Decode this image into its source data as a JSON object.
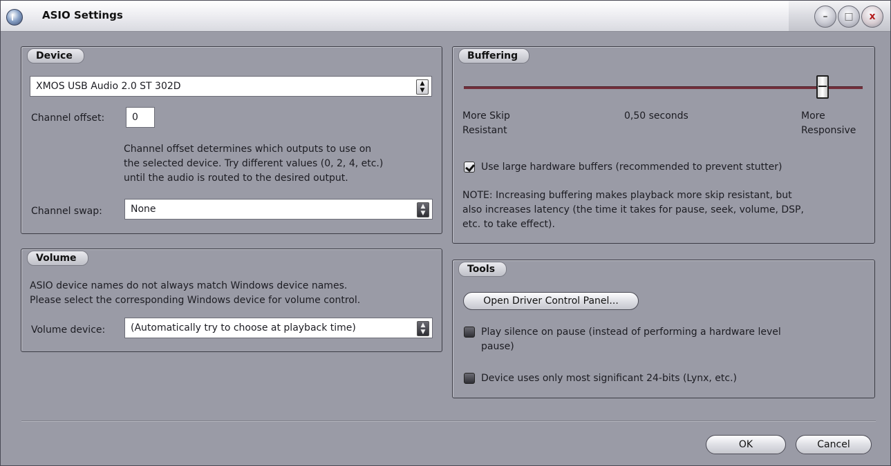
{
  "window": {
    "title": "ASIO Settings",
    "buttons": {
      "minimize": "–",
      "maximize": "□",
      "close": "x"
    }
  },
  "device": {
    "label": "Device",
    "selected_device": "XMOS USB Audio 2.0 ST 302D",
    "channel_offset_label": "Channel offset:",
    "channel_offset_value": "0",
    "help_line1": "Channel offset determines which outputs to use on",
    "help_line2": "the selected device.  Try different values (0, 2, 4, etc.)",
    "help_line3": "until the audio is routed to the desired output.",
    "channel_swap_label": "Channel swap:",
    "channel_swap_value": "None"
  },
  "volume": {
    "label": "Volume",
    "desc_line1": "ASIO device names do not always match Windows device names.",
    "desc_line2": "Please select the corresponding Windows device for volume control.",
    "device_label": "Volume device:",
    "device_value": "(Automatically try to choose at playback time)"
  },
  "buffering": {
    "label": "Buffering",
    "slider_value": 0.9,
    "left_label_line1": "More Skip",
    "left_label_line2": "Resistant",
    "center_label": "0,50 seconds",
    "right_label_line1": "More",
    "right_label_line2": "Responsive",
    "large_buffers_label": "Use large hardware buffers (recommended to prevent stutter)",
    "large_buffers_checked": true,
    "note_line1": "NOTE: Increasing buffering makes playback more skip resistant, but",
    "note_line2": "also increases latency (the time it takes for pause, seek, volume, DSP,",
    "note_line3": "etc. to take effect)."
  },
  "tools": {
    "label": "Tools",
    "open_driver_button": "Open Driver Control Panel...",
    "silence_line1": "Play silence on pause (instead of performing a hardware level",
    "silence_line2": "pause)",
    "silence_checked": false,
    "msb24_label": "Device uses only most significant 24-bits (Lynx, etc.)",
    "msb24_checked": false
  },
  "footer": {
    "ok": "OK",
    "cancel": "Cancel"
  },
  "colors": {
    "panel_bg": "#9a9ba6",
    "slider_track": "#74303c"
  }
}
